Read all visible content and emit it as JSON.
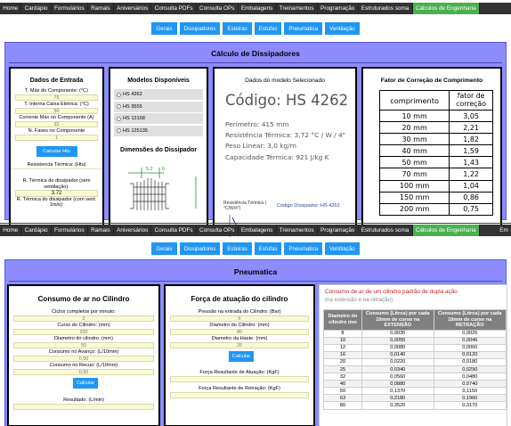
{
  "nav": {
    "items": [
      "Home",
      "Cardápio",
      "Formulários",
      "Ramais",
      "Aniversários",
      "Consulta PDFs",
      "Consulta OPs",
      "Embalagens",
      "Treinamentos",
      "Programação",
      "Estruturados soma",
      "Cálculos de Engenharia"
    ],
    "active": "Cálculos de Engenharia",
    "right_item": "Em"
  },
  "subtabs": [
    "Gerais",
    "Dissipadores",
    "Esteiras",
    "Estufas",
    "Pneumatica",
    "Ventilação"
  ],
  "dissipadores": {
    "title": "Cálculo de Dissipadores",
    "entrada": {
      "heading": "Dados de Entrada",
      "fields": [
        {
          "label": "T. Máx do Componente: (°C)",
          "value": "75"
        },
        {
          "label": "T. Interna Caixa Elétrica: (°C)",
          "value": "50"
        },
        {
          "label": "Corrente Máx no Componente (A)",
          "value": "32"
        },
        {
          "label": "N. Fases no Componente",
          "value": "1"
        }
      ],
      "calc_button": "Calcular Htu",
      "resist_label": "Resistencia Térmica: (Htu)",
      "rtd_label": "R. Térmica do dissipador (sem ventilação):",
      "rtd_value": "3.72",
      "rtd_vent_label": "R. Térmica do dissipador (com vent. 1m/s):"
    },
    "modelos": {
      "heading": "Modelos Disponíveis",
      "items": [
        "HS 4262",
        "HS 9555",
        "HS 12168",
        "HS 125135"
      ],
      "dim_heading": "Dimensões do Dissipador",
      "dim_values": [
        "5.2",
        "6"
      ]
    },
    "dados_modelo": {
      "heading": "Dados do modelo Selecionado",
      "codigo": "Código: HS 4262",
      "perimetro": "Perímetro: 415 mm",
      "resistencia": "Resistência Térmica: 3,72 °C / W / 4\"",
      "peso": "Peso Linear: 3,0 kg/m",
      "capacidade": "Capacidade Térmica: 921 J/kg K",
      "graph_ylabel": "Resistência Térmica ( °C/W/4\")",
      "graph_code": "Código Dissipador: HS 4262"
    },
    "correcao": {
      "heading": "Fator de Correção de Comprimento",
      "col1": "comprimento",
      "col2_a": "fator de",
      "col2_b": "correção",
      "rows": [
        [
          "10 mm",
          "3,05"
        ],
        [
          "20 mm",
          "2,21"
        ],
        [
          "30 mm",
          "1,82"
        ],
        [
          "40 mm",
          "1,59"
        ],
        [
          "50 mm",
          "1,43"
        ],
        [
          "70 mm",
          "1,22"
        ],
        [
          "100 mm",
          "1,04"
        ],
        [
          "150 mm",
          "0,86"
        ],
        [
          "200 mm",
          "0,75"
        ]
      ]
    }
  },
  "pneumatica": {
    "title": "Pneumatica",
    "consumo": {
      "heading": "Consumo de ar no Cilindro",
      "fields": [
        {
          "label": "Ciclos completos por minuto:",
          "value": "2"
        },
        {
          "label": "Curso do Cilindro: (mm)",
          "value": "200"
        },
        {
          "label": "Diametro do cilindro: (mm)",
          "value": "50"
        },
        {
          "label": "Consumo no Avanço: (L/10mm)",
          "value": "0,50"
        },
        {
          "label": "Consumo no Recuo: (L/10mm)",
          "value": "0,50"
        }
      ],
      "button": "Calcular",
      "result_label": "Resultado: (L/min)"
    },
    "forca": {
      "heading": "Força de atuação do cilindro",
      "fields": [
        {
          "label": "Pressão na entrada do Cilindro: (Bar)",
          "value": "6"
        },
        {
          "label": "Diametro do Cilindro: (mm)",
          "value": "80"
        },
        {
          "label": "Diametro da Haste: (mm)",
          "value": "25"
        }
      ],
      "button": "Calcular",
      "res1": "Força Resultante de Atuação: (KgF)",
      "res2": "Força Resultante de Retração: (KgF)"
    },
    "tabela": {
      "title": "Consumo de ar de um cilindro padrão de dupla ação",
      "subtitle": "(na extensão e na retração)",
      "headers": [
        "Diametro do cilindro mm",
        "Consumo (Litros) por cada 10mm de curso na EXTENSÃO",
        "Consumo (Litros) por cada 10mm de curso na RETRAÇÃO"
      ],
      "rows": [
        [
          "8",
          "0,0035",
          "0,0026"
        ],
        [
          "10",
          "0,0055",
          "0,0046"
        ],
        [
          "12",
          "0,0080",
          "0,0060"
        ],
        [
          "16",
          "0,0140",
          "0,0120"
        ],
        [
          "20",
          "0,0220",
          "0,0180"
        ],
        [
          "25",
          "0,0340",
          "0,0290"
        ],
        [
          "32",
          "0,0560",
          "0,0480"
        ],
        [
          "40",
          "0,0880",
          "0,0740"
        ],
        [
          "50",
          "0,1370",
          "0,1150"
        ],
        [
          "63",
          "0,2180",
          "0,1960"
        ],
        [
          "80",
          "0,3520",
          "0,3170"
        ]
      ]
    }
  }
}
